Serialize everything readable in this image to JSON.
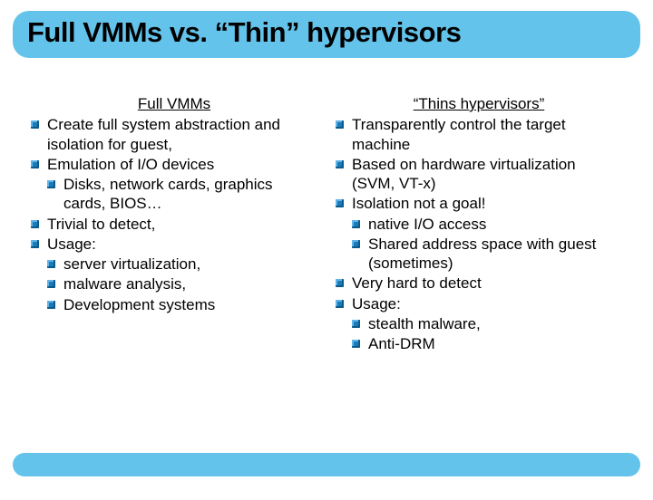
{
  "title": "Full VMMs vs. “Thin” hypervisors",
  "left": {
    "heading": "Full VMMs",
    "items": [
      {
        "text": "Create full system abstraction and isolation for guest,"
      },
      {
        "text": "Emulation of I/O devices",
        "children": [
          {
            "text": "Disks, network cards, graphics cards, BIOS…"
          }
        ]
      },
      {
        "text": "Trivial to detect,"
      },
      {
        "text": "Usage:",
        "children": [
          {
            "text": "server virtualization,"
          },
          {
            "text": "malware analysis,"
          },
          {
            "text": "Development systems"
          }
        ]
      }
    ]
  },
  "right": {
    "heading": "“Thins hypervisors”",
    "items": [
      {
        "text": "Transparently control the target machine"
      },
      {
        "text": "Based on hardware virtualization (SVM, VT-x)"
      },
      {
        "text": "Isolation not a goal!",
        "children": [
          {
            "text": "native I/O access"
          },
          {
            "text": "Shared address space with guest (sometimes)"
          }
        ]
      },
      {
        "text": "Very hard to detect"
      },
      {
        "text": "Usage:",
        "children": [
          {
            "text": "stealth malware,"
          },
          {
            "text": "Anti-DRM"
          }
        ]
      }
    ]
  }
}
